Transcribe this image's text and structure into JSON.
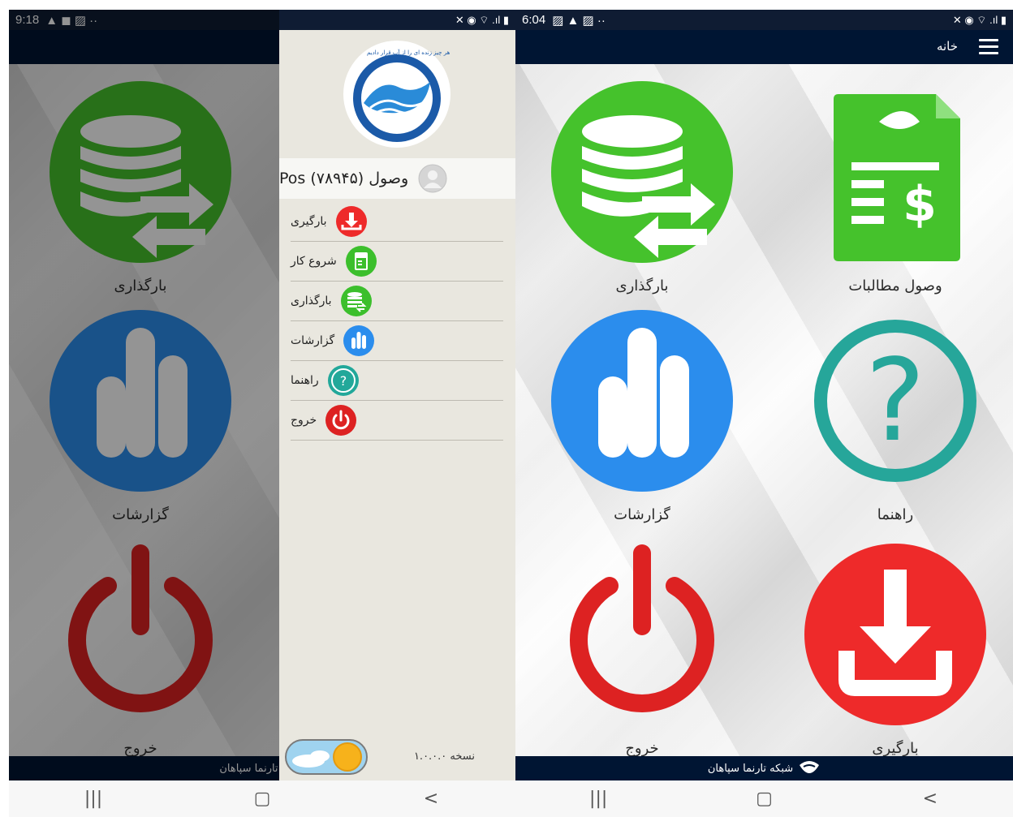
{
  "screenA": {
    "status": {
      "time": "9:18",
      "left_icons": "▲ ◼ ▨ ··",
      "right_icons": "✕ ◉ ⌔ .ıl ▮"
    },
    "tiles": [
      {
        "label": "بارگذاری"
      },
      {
        "label": "گزارشات"
      },
      {
        "label": "خروج"
      }
    ],
    "footer": {
      "text": "شبکه تارنما سپاهان"
    },
    "drawer": {
      "logo_text": "هر چیز زنده ای را از آب قرار دادیم",
      "user": {
        "name": "وصول (۷۸۹۴۵) Pos"
      },
      "menu": [
        {
          "label": "بارگیری",
          "icon": "download-icon",
          "color": "#ee2a2a"
        },
        {
          "label": "شروع کار",
          "icon": "invoice-icon",
          "color": "#3cbf2c"
        },
        {
          "label": "بارگذاری",
          "icon": "database-icon",
          "color": "#3cbf2c"
        },
        {
          "label": "گزارشات",
          "icon": "bar-chart-icon",
          "color": "#2b8ded"
        },
        {
          "label": "راهنما",
          "icon": "help-icon",
          "color": "#22a89a"
        },
        {
          "label": "خروج",
          "icon": "power-icon",
          "color": "#dd2222"
        }
      ],
      "version": "نسخه ۱.۰.۰.۰"
    },
    "navbar": {
      "recents": "|||",
      "home": "▢",
      "back": "<"
    }
  },
  "screenB": {
    "status": {
      "time": "6:04",
      "left_icons": "▨ ▲ ▨ ··",
      "right_icons": "✕ ◉ ⌔ .ıl ▮"
    },
    "app_title": "خانه",
    "tiles": [
      {
        "label": "بارگذاری",
        "icon": "database-icon"
      },
      {
        "label": "وصول مطالبات",
        "icon": "invoice-icon"
      },
      {
        "label": "گزارشات",
        "icon": "bar-chart-icon"
      },
      {
        "label": "راهنما",
        "icon": "help-icon"
      },
      {
        "label": "خروج",
        "icon": "power-icon"
      },
      {
        "label": "بارگیری",
        "icon": "download-icon"
      }
    ],
    "footer": {
      "text": "شبکه تارنما سپاهان"
    },
    "navbar": {
      "recents": "|||",
      "home": "▢",
      "back": "<"
    }
  },
  "colors": {
    "green": "#45c22c",
    "blue": "#2b8ded",
    "teal": "#26a69a",
    "red": "#ee2a2a",
    "dark_navy": "#001533"
  }
}
